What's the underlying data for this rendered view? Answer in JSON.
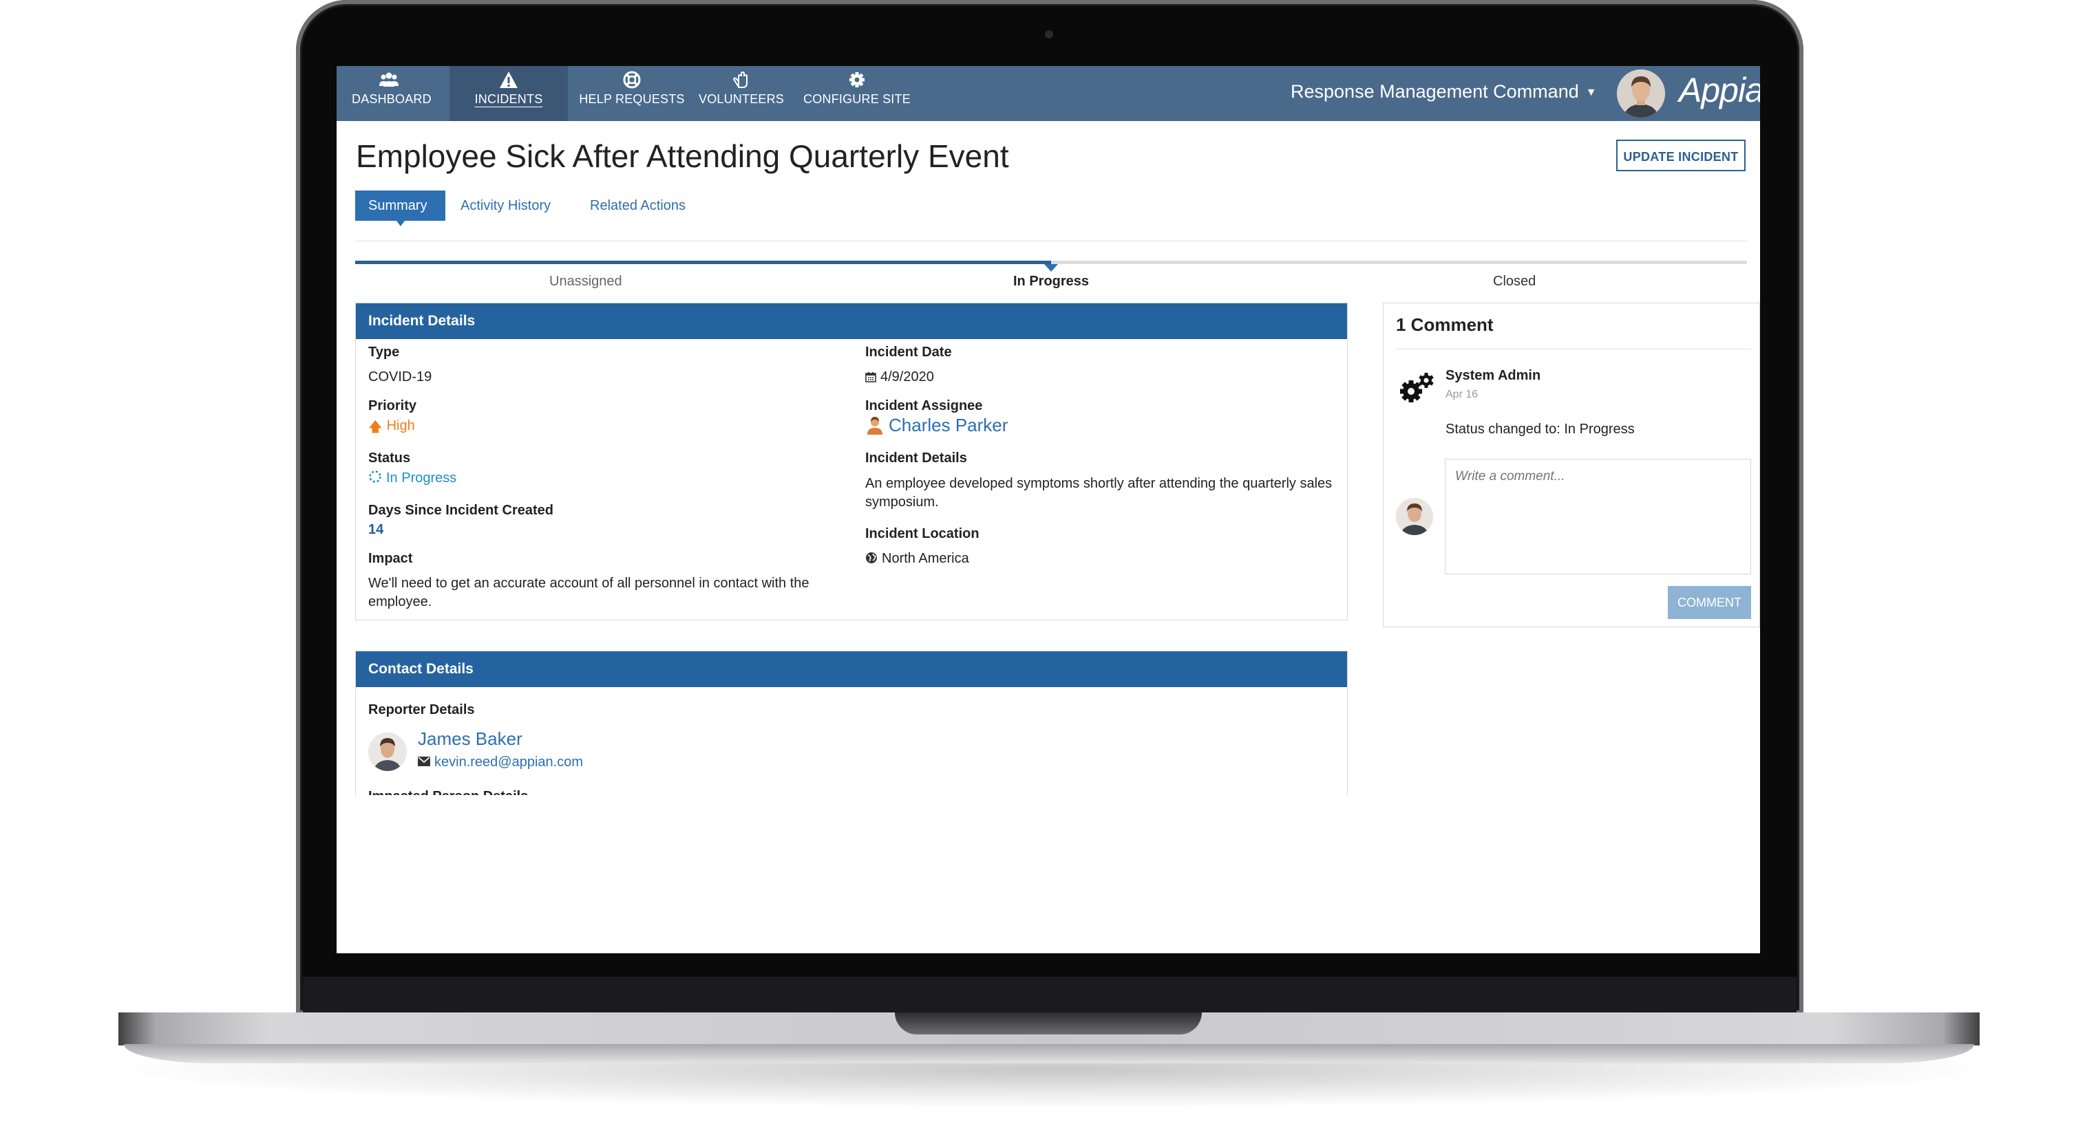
{
  "nav": {
    "items": [
      {
        "label": "DASHBOARD",
        "icon": "users-icon"
      },
      {
        "label": "INCIDENTS",
        "icon": "warning-icon"
      },
      {
        "label": "HELP REQUESTS",
        "icon": "life-ring-icon"
      },
      {
        "label": "VOLUNTEERS",
        "icon": "hand-icon"
      },
      {
        "label": "CONFIGURE SITE",
        "icon": "gear-icon"
      }
    ],
    "active": "INCIDENTS",
    "org_switcher": "Response Management Command",
    "brand": "Appian"
  },
  "page": {
    "title": "Employee Sick After Attending Quarterly Event",
    "update_button": "UPDATE INCIDENT",
    "tabs": [
      "Summary",
      "Activity History",
      "Related Actions"
    ],
    "active_tab": "Summary"
  },
  "progress": {
    "steps": [
      "Unassigned",
      "In Progress",
      "Closed"
    ],
    "current_step": "In Progress",
    "fraction": 0.5
  },
  "incident_details": {
    "header": "Incident Details",
    "type_label": "Type",
    "type": "COVID-19",
    "priority_label": "Priority",
    "priority": "High",
    "status_label": "Status",
    "status": "In Progress",
    "days_label": "Days Since Incident Created",
    "days": "14",
    "impact_label": "Impact",
    "impact": "We'll need to get an accurate account of all personnel in contact with the employee.",
    "date_label": "Incident Date",
    "date": "4/9/2020",
    "assignee_label": "Incident Assignee",
    "assignee": "Charles Parker",
    "details_label": "Incident Details",
    "details": "An employee developed symptoms shortly after attending the quarterly sales symposium.",
    "location_label": "Incident Location",
    "location": "North America"
  },
  "contact_details": {
    "header": "Contact Details",
    "reporter_label": "Reporter Details",
    "reporter_name": "James Baker",
    "reporter_email": "kevin.reed@appian.com",
    "impacted_label": "Impacted Person Details"
  },
  "comments": {
    "title": "1 Comment",
    "items": [
      {
        "author": "System Admin",
        "date": "Apr 16",
        "text": "Status changed to: In Progress"
      }
    ],
    "placeholder": "Write a comment...",
    "button": "COMMENT"
  },
  "colors": {
    "nav_bg": "#4a6a8c",
    "header_blue": "#2563a0",
    "link_blue": "#2d6fb0",
    "priority_orange": "#f07d1a",
    "status_cyan": "#1b8fc9"
  }
}
